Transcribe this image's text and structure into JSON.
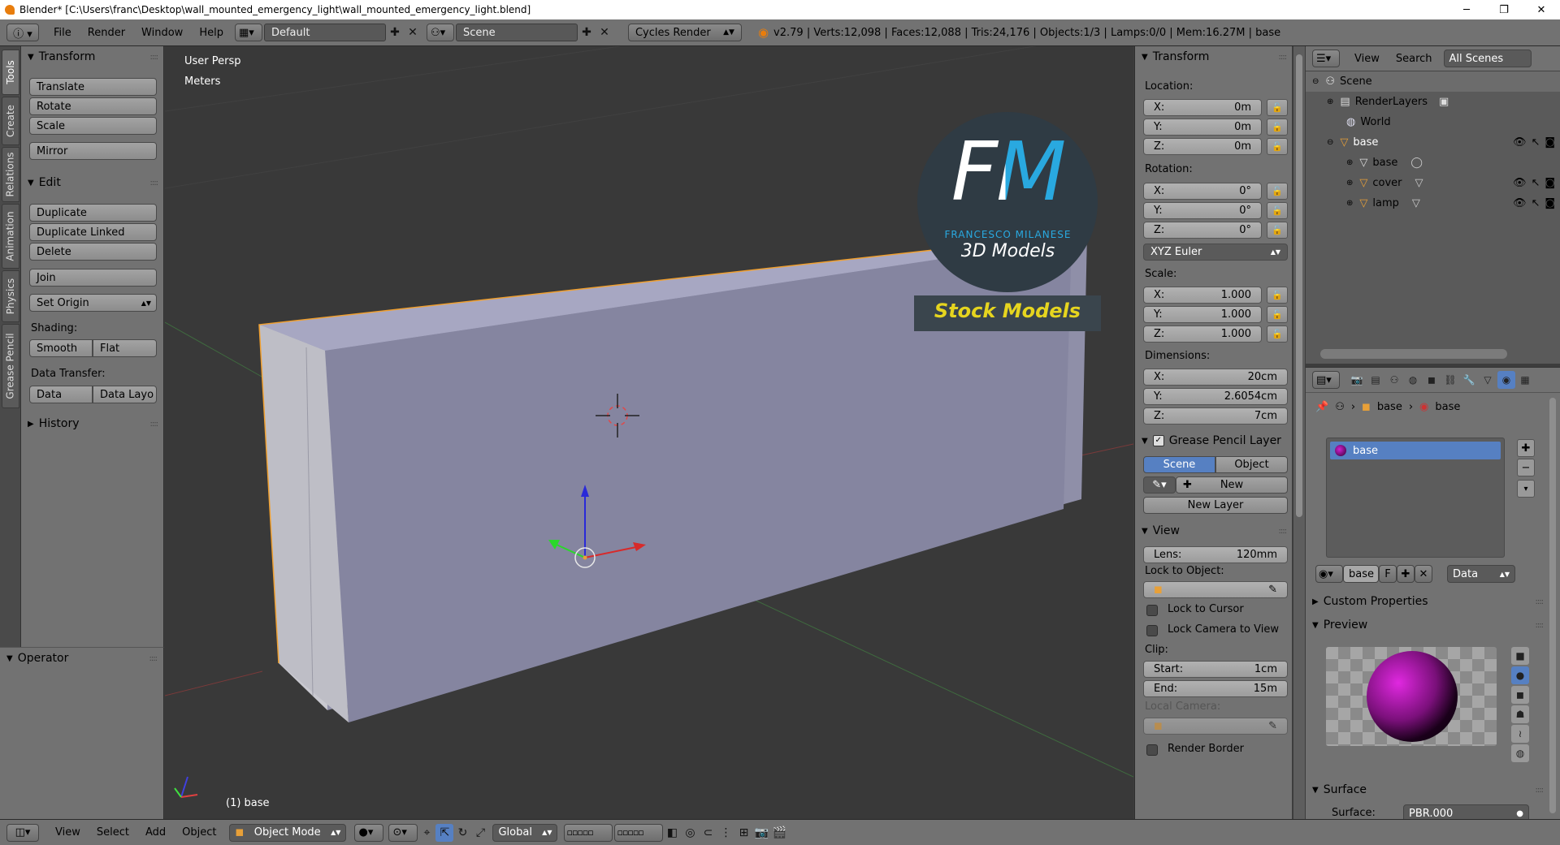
{
  "window": {
    "title": "Blender* [C:\\Users\\franc\\Desktop\\wall_mounted_emergency_light\\wall_mounted_emergency_light.blend]",
    "minimize": "─",
    "maximize": "❐",
    "close": "✕"
  },
  "info_header": {
    "menus": [
      "File",
      "Render",
      "Window",
      "Help"
    ],
    "layout": "Default",
    "scene": "Scene",
    "render_engine": "Cycles Render",
    "stats": "v2.79 | Verts:12,098 | Faces:12,088 | Tris:24,176 | Objects:1/3 | Lamps:0/0 | Mem:16.27M | base"
  },
  "tool_tabs": [
    "Tools",
    "Create",
    "Relations",
    "Animation",
    "Physics",
    "Grease Pencil"
  ],
  "toolshelf": {
    "transform_title": "Transform",
    "transform_buttons": [
      "Translate",
      "Rotate",
      "Scale"
    ],
    "mirror": "Mirror",
    "edit_title": "Edit",
    "edit_buttons": [
      "Duplicate",
      "Duplicate Linked",
      "Delete"
    ],
    "join": "Join",
    "set_origin": "Set Origin",
    "shading_label": "Shading:",
    "smooth": "Smooth",
    "flat": "Flat",
    "data_transfer_label": "Data Transfer:",
    "data": "Data",
    "data_layout": "Data Layo",
    "history_title": "History"
  },
  "operator_panel": {
    "title": "Operator"
  },
  "viewport": {
    "view_name": "User Persp",
    "units": "Meters",
    "object_label": "(1) base",
    "logo_letters": "FM",
    "logo_author": "FRANCESCO MILANESE",
    "logo_sub": "3D Models",
    "logo_banner": "Stock Models"
  },
  "n_panel": {
    "transform_title": "Transform",
    "location_label": "Location:",
    "location": [
      {
        "k": "X:",
        "v": "0m"
      },
      {
        "k": "Y:",
        "v": "0m"
      },
      {
        "k": "Z:",
        "v": "0m"
      }
    ],
    "rotation_label": "Rotation:",
    "rotation": [
      {
        "k": "X:",
        "v": "0°"
      },
      {
        "k": "Y:",
        "v": "0°"
      },
      {
        "k": "Z:",
        "v": "0°"
      }
    ],
    "rotation_mode": "XYZ Euler",
    "scale_label": "Scale:",
    "scale": [
      {
        "k": "X:",
        "v": "1.000"
      },
      {
        "k": "Y:",
        "v": "1.000"
      },
      {
        "k": "Z:",
        "v": "1.000"
      }
    ],
    "dimensions_label": "Dimensions:",
    "dimensions": [
      {
        "k": "X:",
        "v": "20cm"
      },
      {
        "k": "Y:",
        "v": "2.6054cm"
      },
      {
        "k": "Z:",
        "v": "7cm"
      }
    ],
    "grease_pencil_title": "Grease Pencil Layer",
    "gp_scene": "Scene",
    "gp_object": "Object",
    "gp_new": "New",
    "gp_new_layer": "New Layer",
    "view_title": "View",
    "lens_label": "Lens:",
    "lens_value": "120mm",
    "lock_to_object": "Lock to Object:",
    "lock_to_cursor": "Lock to Cursor",
    "lock_camera": "Lock Camera to View",
    "clip_label": "Clip:",
    "clip_start_label": "Start:",
    "clip_start": "1cm",
    "clip_end_label": "End:",
    "clip_end": "15m",
    "local_camera": "Local Camera:",
    "render_border": "Render Border"
  },
  "outliner": {
    "view": "View",
    "search": "Search",
    "filter": "All Scenes",
    "items": [
      "Scene",
      "RenderLayers",
      "World",
      "base",
      "base",
      "cover",
      "lamp"
    ]
  },
  "properties": {
    "breadcrumb_object": "base",
    "breadcrumb_material": "base",
    "slot_name": "base",
    "material_name": "base",
    "fake_user": "F",
    "link": "Data",
    "custom_properties": "Custom Properties",
    "preview_title": "Preview",
    "surface_title": "Surface",
    "surface_label": "Surface:",
    "surface_value": "PBR.000"
  },
  "bottom_bar": {
    "menus": [
      "View",
      "Select",
      "Add",
      "Object"
    ],
    "mode": "Object Mode",
    "orientation": "Global"
  },
  "colors": {
    "accent_blue": "#5680c2",
    "selection_orange": "#f0a030",
    "logo_blue": "#29a9e0",
    "banner_yellow": "#e6d51f"
  }
}
